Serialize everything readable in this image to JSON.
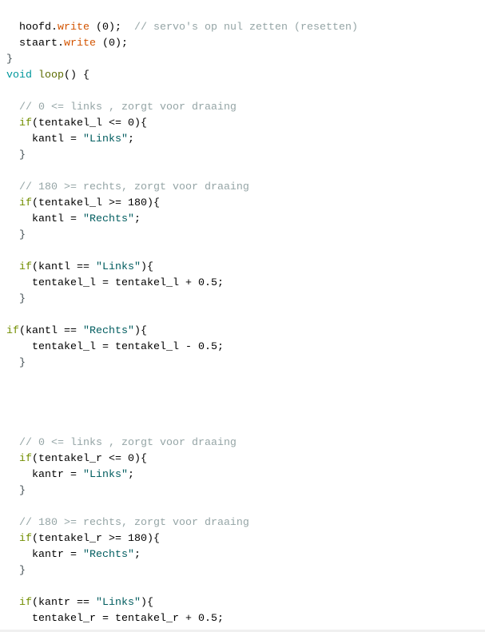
{
  "code_lines": [
    [
      [
        "  hoofd.",
        "plain"
      ],
      [
        "write",
        "method"
      ],
      [
        " (0);  ",
        "plain"
      ],
      [
        "// servo's op nul zetten (resetten)",
        "comment"
      ]
    ],
    [
      [
        "  staart.",
        "plain"
      ],
      [
        "write",
        "method"
      ],
      [
        " (0);",
        "plain"
      ]
    ],
    [
      [
        "}",
        "brace"
      ]
    ],
    [
      [
        "void",
        "type"
      ],
      [
        " ",
        "plain"
      ],
      [
        "loop",
        "func"
      ],
      [
        "() {",
        "plain"
      ]
    ],
    [],
    [
      [
        "  // 0 <= links , zorgt voor draaing",
        "comment"
      ]
    ],
    [
      [
        "  ",
        "plain"
      ],
      [
        "if",
        "keyword"
      ],
      [
        "(tentakel_l <= 0){",
        "plain"
      ]
    ],
    [
      [
        "    kantl = ",
        "plain"
      ],
      [
        "\"Links\"",
        "string"
      ],
      [
        ";",
        "plain"
      ]
    ],
    [
      [
        "  }",
        "brace"
      ]
    ],
    [],
    [
      [
        "  // 180 >= rechts, zorgt voor draaing",
        "comment"
      ]
    ],
    [
      [
        "  ",
        "plain"
      ],
      [
        "if",
        "keyword"
      ],
      [
        "(tentakel_l >= 180){",
        "plain"
      ]
    ],
    [
      [
        "    kantl = ",
        "plain"
      ],
      [
        "\"Rechts\"",
        "string"
      ],
      [
        ";",
        "plain"
      ]
    ],
    [
      [
        "  }",
        "brace"
      ]
    ],
    [],
    [
      [
        "  ",
        "plain"
      ],
      [
        "if",
        "keyword"
      ],
      [
        "(kantl == ",
        "plain"
      ],
      [
        "\"Links\"",
        "string"
      ],
      [
        "){",
        "plain"
      ]
    ],
    [
      [
        "    tentakel_l = tentakel_l + 0.5;",
        "plain"
      ]
    ],
    [
      [
        "  }",
        "brace"
      ]
    ],
    [],
    [
      [
        "if",
        "keyword"
      ],
      [
        "(kantl == ",
        "plain"
      ],
      [
        "\"Rechts\"",
        "string"
      ],
      [
        "){",
        "plain"
      ]
    ],
    [
      [
        "    tentakel_l = tentakel_l - 0.5;",
        "plain"
      ]
    ],
    [
      [
        "  }",
        "brace"
      ]
    ],
    [],
    [],
    [],
    [],
    [
      [
        "  // 0 <= links , zorgt voor draaing",
        "comment"
      ]
    ],
    [
      [
        "  ",
        "plain"
      ],
      [
        "if",
        "keyword"
      ],
      [
        "(tentakel_r <= 0){",
        "plain"
      ]
    ],
    [
      [
        "    kantr = ",
        "plain"
      ],
      [
        "\"Links\"",
        "string"
      ],
      [
        ";",
        "plain"
      ]
    ],
    [
      [
        "  }",
        "brace"
      ]
    ],
    [],
    [
      [
        "  // 180 >= rechts, zorgt voor draaing",
        "comment"
      ]
    ],
    [
      [
        "  ",
        "plain"
      ],
      [
        "if",
        "keyword"
      ],
      [
        "(tentakel_r >= 180){",
        "plain"
      ]
    ],
    [
      [
        "    kantr = ",
        "plain"
      ],
      [
        "\"Rechts\"",
        "string"
      ],
      [
        ";",
        "plain"
      ]
    ],
    [
      [
        "  }",
        "brace"
      ]
    ],
    [],
    [
      [
        "  ",
        "plain"
      ],
      [
        "if",
        "keyword"
      ],
      [
        "(kantr == ",
        "plain"
      ],
      [
        "\"Links\"",
        "string"
      ],
      [
        "){",
        "plain"
      ]
    ],
    [
      [
        "    tentakel_r = tentakel_r + 0.5;",
        "plain"
      ]
    ]
  ],
  "colors": {
    "comment": "#95a5a6",
    "keyword": "#728e00",
    "type": "#00979c",
    "function": "#5e6d03",
    "method": "#d35400",
    "string": "#005c5f"
  }
}
